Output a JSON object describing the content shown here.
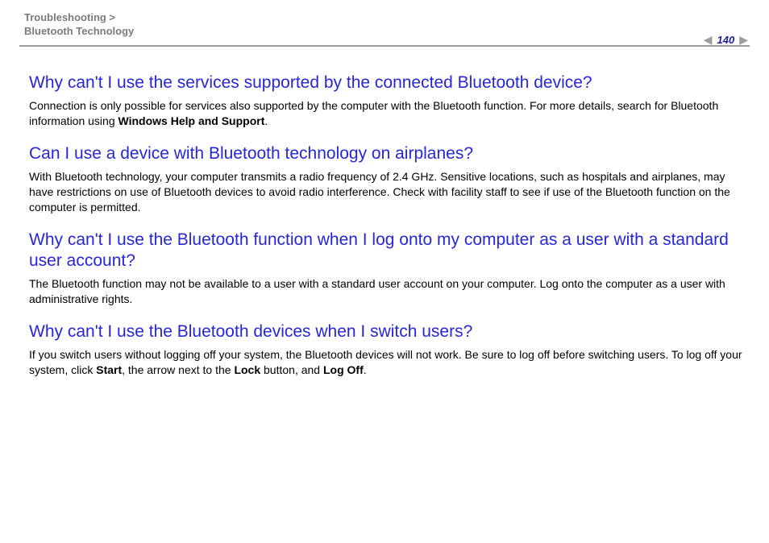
{
  "header": {
    "breadcrumb_line1": "Troubleshooting >",
    "breadcrumb_line2": "Bluetooth Technology",
    "page_number": "140"
  },
  "sections": [
    {
      "heading": "Why can't I use the services supported by the connected Bluetooth device?",
      "body_pre": "Connection is only possible for services also supported by the computer with the Bluetooth function. For more details, search for Bluetooth information using ",
      "body_bold": "Windows Help and Support",
      "body_post": "."
    },
    {
      "heading": "Can I use a device with Bluetooth technology on airplanes?",
      "body": "With Bluetooth technology, your computer transmits a radio frequency of 2.4 GHz. Sensitive locations, such as hospitals and airplanes, may have restrictions on use of Bluetooth devices to avoid radio interference. Check with facility staff to see if use of the Bluetooth function on the computer is permitted."
    },
    {
      "heading": "Why can't I use the Bluetooth function when I log onto my computer as a user with a standard user account?",
      "body": "The Bluetooth function may not be available to a user with a standard user account on your computer. Log onto the computer as a user with administrative rights."
    },
    {
      "heading": "Why can't I use the Bluetooth devices when I switch users?",
      "body_pre": "If you switch users without logging off your system, the Bluetooth devices will not work. Be sure to log off before switching users. To log off your system, click ",
      "body_bold1": "Start",
      "body_mid1": ", the arrow next to the ",
      "body_bold2": "Lock",
      "body_mid2": " button, and ",
      "body_bold3": "Log Off",
      "body_post": "."
    }
  ]
}
